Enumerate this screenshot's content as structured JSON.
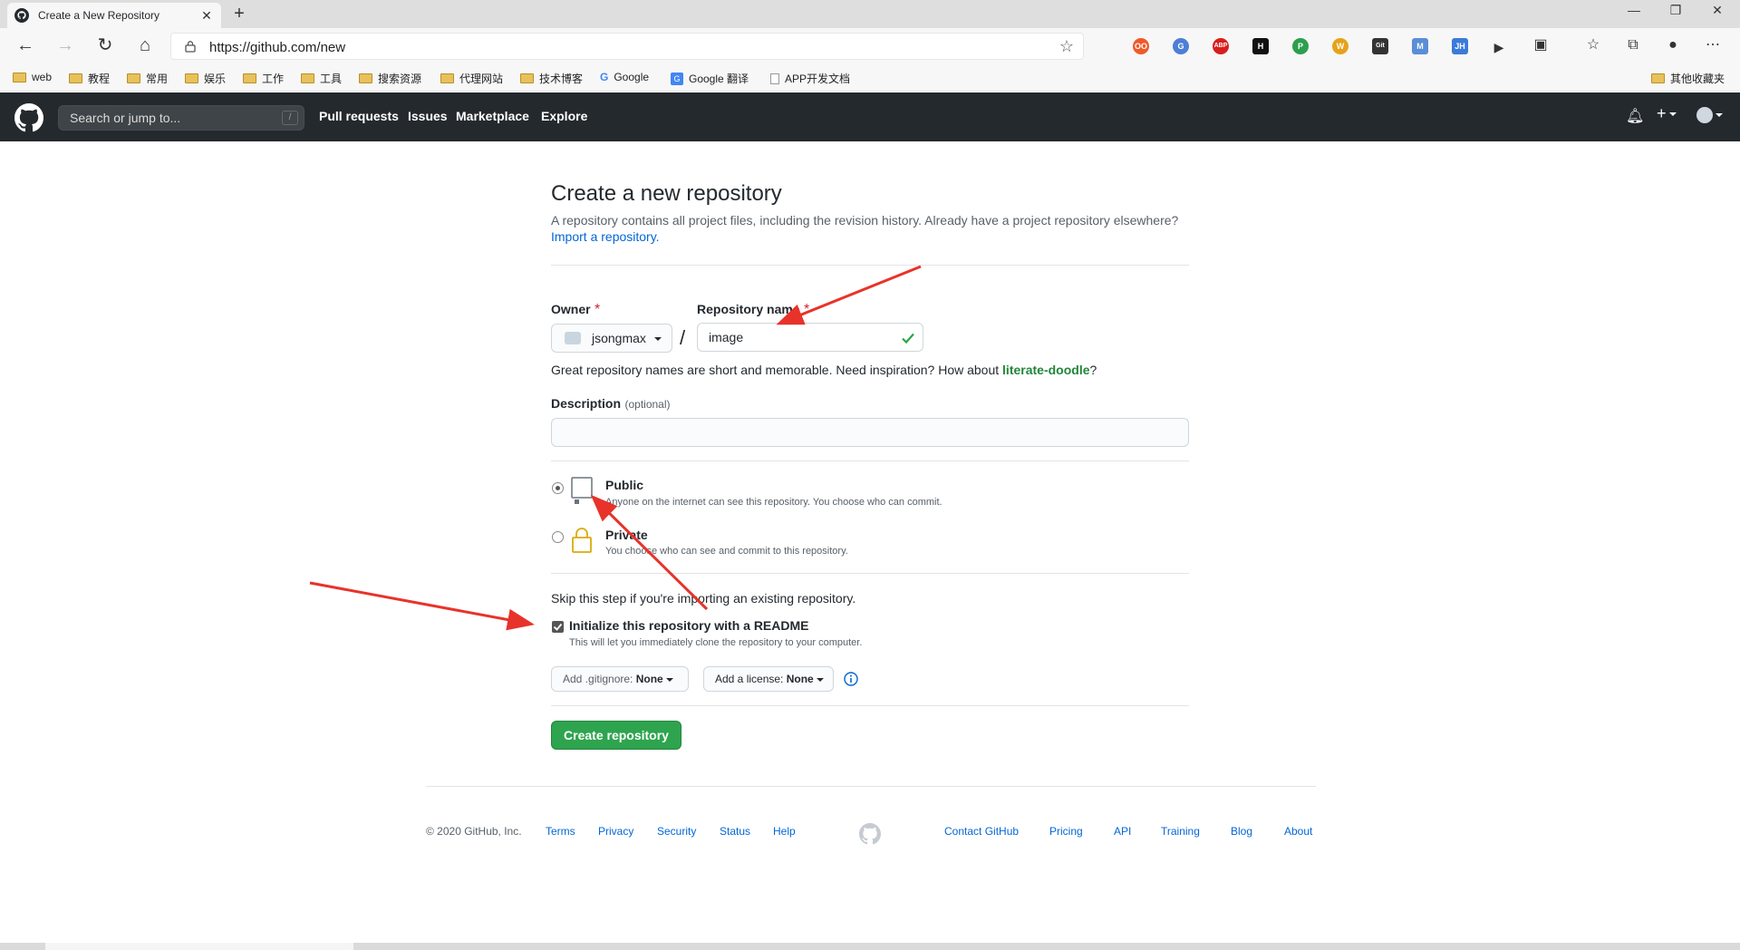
{
  "browser": {
    "tab_title": "Create a New Repository",
    "tab_close": "✕",
    "new_tab": "+",
    "url": "https://github.com/new",
    "bookmarks": [
      "web",
      "教程",
      "常用",
      "娱乐",
      "工作",
      "工具",
      "搜索资源",
      "代理网站",
      "技术博客",
      "Google",
      "Google 翻译",
      "APP开发文档"
    ],
    "bookmark_right": "其他收藏夹",
    "extensions": [
      "OO",
      "G",
      "ABP",
      "H",
      "P",
      "W",
      "Git",
      "M",
      "JH"
    ]
  },
  "github_header": {
    "search_placeholder": "Search or jump to...",
    "search_shortcut": "/",
    "nav": [
      "Pull requests",
      "Issues",
      "Marketplace",
      "Explore"
    ]
  },
  "form": {
    "title": "Create a new repository",
    "lead": "A repository contains all project files, including the revision history. Already have a project repository elsewhere?",
    "import_link": "Import a repository.",
    "owner_label": "Owner",
    "required_mark": "*",
    "owner_value": "jsongmax",
    "separator": "/",
    "repo_label": "Repository name",
    "repo_value": "image",
    "hint_prefix": "Great repository names are short and memorable. Need inspiration? How about ",
    "hint_suggestion": "literate-doodle",
    "hint_suffix": "?",
    "description_label": "Description",
    "description_optional": "(optional)",
    "description_value": "",
    "visibility": {
      "public_title": "Public",
      "public_desc": "Anyone on the internet can see this repository. You choose who can commit.",
      "private_title": "Private",
      "private_desc": "You choose who can see and commit to this repository.",
      "selected": "public"
    },
    "skip_note": "Skip this step if you're importing an existing repository.",
    "readme_label": "Initialize this repository with a README",
    "readme_desc": "This will let you immediately clone the repository to your computer.",
    "readme_checked": true,
    "gitignore_label": "Add .gitignore:",
    "gitignore_value": "None",
    "license_label": "Add a license:",
    "license_value": "None",
    "create_button": "Create repository"
  },
  "footer": {
    "copyright": "© 2020 GitHub, Inc.",
    "left_links": [
      "Terms",
      "Privacy",
      "Security",
      "Status",
      "Help"
    ],
    "right_links": [
      "Contact GitHub",
      "Pricing",
      "API",
      "Training",
      "Blog",
      "About"
    ]
  },
  "colors": {
    "github_header": "#24292e",
    "create_button": "#2ea44f",
    "link": "#0366d6",
    "required": "#cb2431",
    "annotation_arrow": "#e8332a"
  }
}
